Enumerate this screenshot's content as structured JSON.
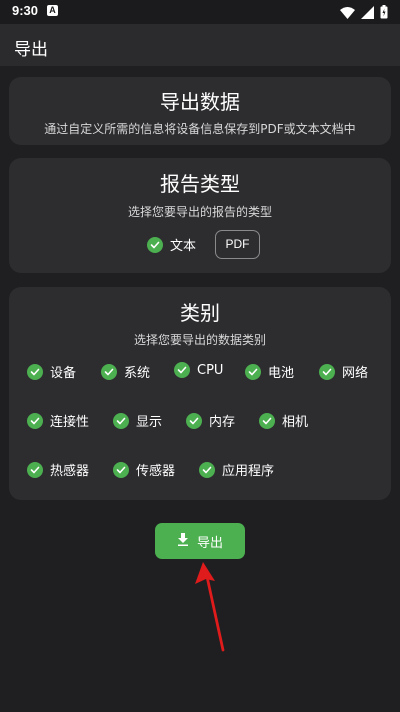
{
  "status_bar": {
    "time": "9:30",
    "notification_letter": "A"
  },
  "app_bar": {
    "title": "导出"
  },
  "export_data_card": {
    "title": "导出数据",
    "subtitle": "通过自定义所需的信息将设备信息保存到PDF或文本文档中"
  },
  "report_type_card": {
    "title": "报告类型",
    "subtitle": "选择您要导出的报告的类型",
    "options": [
      {
        "label": "文本",
        "checked": true
      },
      {
        "label": "PDF",
        "checked": false
      }
    ]
  },
  "category_card": {
    "title": "类别",
    "subtitle": "选择您要导出的数据类别",
    "items": [
      {
        "label": "设备",
        "checked": true
      },
      {
        "label": "系统",
        "checked": true
      },
      {
        "label": "CPU",
        "checked": true
      },
      {
        "label": "电池",
        "checked": true
      },
      {
        "label": "网络",
        "checked": true
      },
      {
        "label": "连接性",
        "checked": true
      },
      {
        "label": "显示",
        "checked": true
      },
      {
        "label": "内存",
        "checked": true
      },
      {
        "label": "相机",
        "checked": true
      },
      {
        "label": "热感器",
        "checked": true
      },
      {
        "label": "传感器",
        "checked": true
      },
      {
        "label": "应用程序",
        "checked": true
      }
    ]
  },
  "export_button": {
    "label": "导出",
    "icon": "download-icon"
  },
  "colors": {
    "accent_green": "#4caf50",
    "annotation_red": "#e01b1b",
    "card_bg": "#2d2d30",
    "page_bg": "#1f1f21"
  }
}
